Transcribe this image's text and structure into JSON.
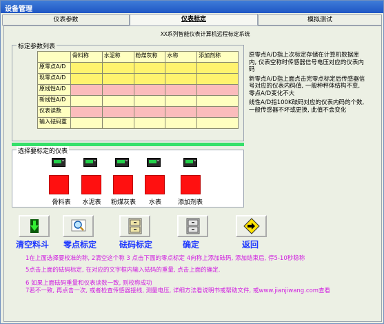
{
  "window": {
    "title": "设备管理"
  },
  "tabs": [
    {
      "label": "仪表参数"
    },
    {
      "label": "仪表标定"
    },
    {
      "label": "模拟测试"
    }
  ],
  "system_name": "XX系列智能仪表计算机远程标定系统",
  "params_group": {
    "legend": "标定参数列表",
    "columns": [
      "",
      "骨料称",
      "水泥称",
      "粉煤灰称",
      "水称",
      "添加剂称"
    ],
    "rows": [
      {
        "label": "原零点A/D"
      },
      {
        "label": "现零点A/D"
      },
      {
        "label": "原线性A/D"
      },
      {
        "label": "新线性A/D"
      },
      {
        "label": "仪表读数"
      },
      {
        "label": "输入砝码重"
      }
    ]
  },
  "info": {
    "p1": "原零点A/D指上次标定存储在计算机数据库内, 仪表空称时传感器信号电压对应的仪表内码",
    "p2": "新零点A/D指上面点击完零点标定后传感器信号对应的仪表内码值, 一般种秤体结构不变, 零点A/D变化不大",
    "p3": "线性A/D指100K砝码对应的仪表内码的个数, 一般传感器不坏或更换, 此值不会变化"
  },
  "select_group": {
    "legend": "选择要标定的仪表",
    "meters": [
      {
        "label": "骨料表"
      },
      {
        "label": "水泥表"
      },
      {
        "label": "粉煤灰表"
      },
      {
        "label": "水表"
      },
      {
        "label": "添加剂表"
      }
    ]
  },
  "buttons": {
    "clear": "清空料斗",
    "zero": "零点标定",
    "weight": "砝码标定",
    "confirm": "确定",
    "back": "返回"
  },
  "instructions": {
    "l1": "1在上面选择要校准的称,  2清空这个称  3 点击下面的零点标定  4向称上添加砝码, 添加结束后, 停5-10秒稳称",
    "l2": "5点击上面的砝码标定, 在对应的文字框内输入砝码的重量, 点击上面的确定.",
    "l3": "6  如果上面砝码重量和仪表读数一致, 则校称成功",
    "l4": "7若不一致, 再点击一次, 或者检查传感器接线, 测量电压, 详细方法看说明书或帮助文件, 或www.jianjiwang.com查看"
  },
  "colors": {
    "title_bar": "#1f56c4",
    "button_label": "#1f39ff",
    "instruction_text": "#d01ee0",
    "indicator_red": "#ff1010",
    "separator_green": "#36e06a"
  }
}
